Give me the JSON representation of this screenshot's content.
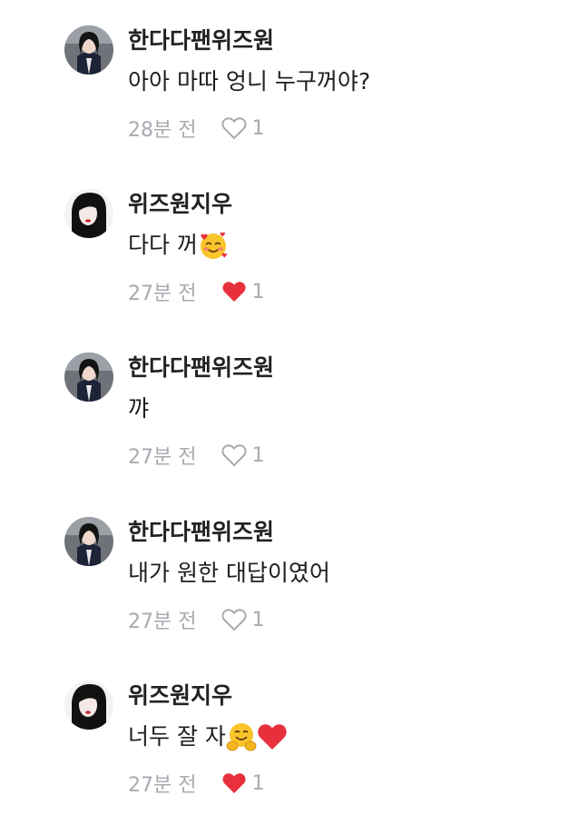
{
  "comments": [
    {
      "username": "한다다팬위즈원",
      "text": "아아 마따 엉니 누구꺼야?",
      "emojis": [],
      "time": "28분 전",
      "liked": false,
      "like_count": "1",
      "avatar": "avatar-dark-hair-uniform"
    },
    {
      "username": "위즈원지우",
      "text": "다다 꺼",
      "emojis": [
        "smiling-face-with-hearts"
      ],
      "time": "27분 전",
      "liked": true,
      "like_count": "1",
      "avatar": "avatar-long-hair-red-lips"
    },
    {
      "username": "한다다팬위즈원",
      "text": "꺄",
      "emojis": [],
      "time": "27분 전",
      "liked": false,
      "like_count": "1",
      "avatar": "avatar-dark-hair-uniform"
    },
    {
      "username": "한다다팬위즈원",
      "text": "내가 원한 대답이였어",
      "emojis": [],
      "time": "27분 전",
      "liked": false,
      "like_count": "1",
      "avatar": "avatar-dark-hair-uniform"
    },
    {
      "username": "위즈원지우",
      "text": "너두 잘 자",
      "emojis": [
        "hugging-face",
        "red-heart"
      ],
      "time": "27분 전",
      "liked": true,
      "like_count": "1",
      "avatar": "avatar-long-hair-red-lips"
    }
  ],
  "colors": {
    "liked_heart": "#e8303d",
    "unliked_heart_outline": "#a8aab0",
    "meta_text": "#a8aab0",
    "text": "#1e1e1e"
  }
}
